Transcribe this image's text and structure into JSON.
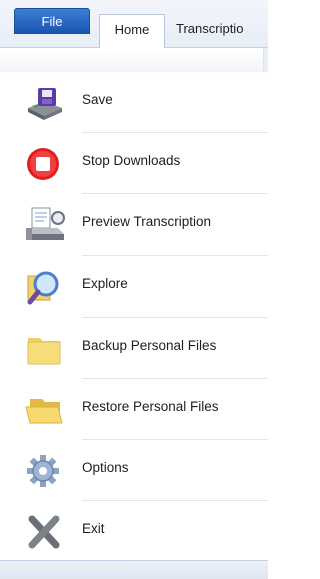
{
  "tabs": {
    "file": "File",
    "home": "Home",
    "transcription": "Transcriptio"
  },
  "menu": {
    "items": [
      {
        "label": "Save",
        "icon": "floppy-disk-icon"
      },
      {
        "label": "Stop Downloads",
        "icon": "stop-icon"
      },
      {
        "label": "Preview Transcription",
        "icon": "printer-preview-icon"
      },
      {
        "label": "Explore",
        "icon": "magnifier-icon"
      },
      {
        "label": "Backup Personal Files",
        "icon": "folder-icon"
      },
      {
        "label": "Restore Personal Files",
        "icon": "open-folder-icon"
      },
      {
        "label": "Options",
        "icon": "gear-icon"
      },
      {
        "label": "Exit",
        "icon": "close-x-icon"
      }
    ]
  },
  "colors": {
    "file_tab": "#2a64c2",
    "stop_red": "#e02020",
    "folder_yellow": "#f7de7a"
  }
}
